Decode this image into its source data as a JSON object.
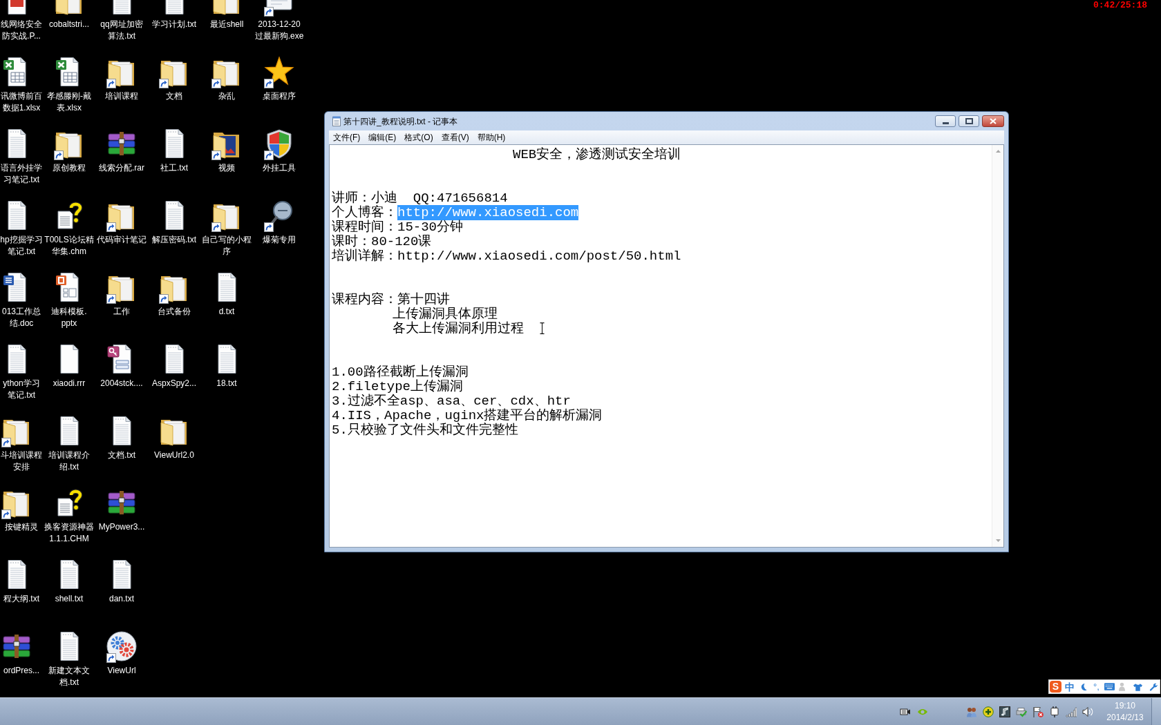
{
  "recording_timer": "0:42/25:18",
  "desktop": {
    "rows": [
      {
        "icons": [
          {
            "label": "线网络安全防实战.P...",
            "kind": "document",
            "shortcut": false
          },
          {
            "label": "cobaltstri...",
            "kind": "folder",
            "shortcut": false
          },
          {
            "label": "qq网址加密算法.txt",
            "kind": "text-file",
            "shortcut": false
          },
          {
            "label": "学习计划.txt",
            "kind": "text-file",
            "shortcut": false
          },
          {
            "label": "最近shell",
            "kind": "folder",
            "shortcut": false
          },
          {
            "label": "2013-12-20过最新狗.exe",
            "kind": "program",
            "shortcut": true
          }
        ]
      },
      {
        "icons": [
          {
            "label": "讯微博前百数据1.xlsx",
            "kind": "spreadsheet",
            "shortcut": false
          },
          {
            "label": "孝感滕刚-戴表.xlsx",
            "kind": "spreadsheet",
            "shortcut": false
          },
          {
            "label": "培训课程",
            "kind": "folder",
            "shortcut": true
          },
          {
            "label": "文档",
            "kind": "folder",
            "shortcut": true
          },
          {
            "label": "杂乱",
            "kind": "folder",
            "shortcut": true
          },
          {
            "label": "桌面程序",
            "kind": "star",
            "shortcut": true
          }
        ]
      },
      {
        "icons": [
          {
            "label": "语言外挂学习笔记.txt",
            "kind": "text-file",
            "shortcut": false
          },
          {
            "label": "原创教程",
            "kind": "folder",
            "shortcut": true
          },
          {
            "label": "线索分配.rar",
            "kind": "archive",
            "shortcut": false
          },
          {
            "label": "社工.txt",
            "kind": "text-file",
            "shortcut": false
          },
          {
            "label": "视频",
            "kind": "media-folder",
            "shortcut": true
          },
          {
            "label": "外挂工具",
            "kind": "shield",
            "shortcut": true
          }
        ]
      },
      {
        "icons": [
          {
            "label": "hp挖掘学习笔记.txt",
            "kind": "text-file",
            "shortcut": false
          },
          {
            "label": "T00LS论坛精华集.chm",
            "kind": "help-file",
            "shortcut": false
          },
          {
            "label": "代码审计笔记",
            "kind": "folder",
            "shortcut": true
          },
          {
            "label": "解压密码.txt",
            "kind": "text-file",
            "shortcut": false
          },
          {
            "label": "自己写的小程序",
            "kind": "folder",
            "shortcut": true
          },
          {
            "label": "爆菊专用",
            "kind": "magnifier",
            "shortcut": true
          }
        ]
      },
      {
        "icons": [
          {
            "label": "013工作总结.doc",
            "kind": "word-document",
            "shortcut": false
          },
          {
            "label": "迪科模板.pptx",
            "kind": "presentation",
            "shortcut": false
          },
          {
            "label": "工作",
            "kind": "folder",
            "shortcut": true
          },
          {
            "label": "台式备份",
            "kind": "folder",
            "shortcut": true
          },
          {
            "label": "d.txt",
            "kind": "text-file",
            "shortcut": false
          }
        ]
      },
      {
        "icons": [
          {
            "label": "ython学习笔记.txt",
            "kind": "text-file",
            "shortcut": false
          },
          {
            "label": "xiaodi.rrr",
            "kind": "blank-file",
            "shortcut": false
          },
          {
            "label": "2004stck....",
            "kind": "database-file",
            "shortcut": false
          },
          {
            "label": "AspxSpy2...",
            "kind": "text-file",
            "shortcut": false
          },
          {
            "label": "18.txt",
            "kind": "text-file",
            "shortcut": false
          }
        ]
      },
      {
        "icons": [
          {
            "label": "斗培训课程安排",
            "kind": "folder",
            "shortcut": true
          },
          {
            "label": "培训课程介绍.txt",
            "kind": "text-file",
            "shortcut": false
          },
          {
            "label": "文档.txt",
            "kind": "text-file",
            "shortcut": false
          },
          {
            "label": "ViewUrl2.0",
            "kind": "folder",
            "shortcut": false
          }
        ]
      },
      {
        "icons": [
          {
            "label": "按键精灵",
            "kind": "folder",
            "shortcut": true
          },
          {
            "label": "换客资源神器1.1.1.CHM",
            "kind": "help-file",
            "shortcut": false
          },
          {
            "label": "MyPower3...",
            "kind": "archive",
            "shortcut": false
          }
        ]
      },
      {
        "icons": [
          {
            "label": "程大纲.txt",
            "kind": "text-file",
            "shortcut": false
          },
          {
            "label": "shell.txt",
            "kind": "text-file",
            "shortcut": false
          },
          {
            "label": "dan.txt",
            "kind": "text-file",
            "shortcut": false
          }
        ]
      },
      {
        "icons": [
          {
            "label": "ordPres...",
            "kind": "archive",
            "shortcut": false
          },
          {
            "label": "新建文本文档.txt",
            "kind": "text-file",
            "shortcut": false
          },
          {
            "label": "ViewUrl",
            "kind": "gears",
            "shortcut": true
          }
        ]
      }
    ]
  },
  "notepad": {
    "title": "第十四讲_教程说明.txt - 记事本",
    "menu": [
      "文件(F)",
      "编辑(E)",
      "格式(O)",
      "查看(V)",
      "帮助(H)"
    ],
    "paragraphs": [
      {
        "lines": [
          {
            "kind": "heading",
            "segments": [
              {
                "text": "WEB安全，渗透测试安全培训",
                "selected": false
              }
            ]
          }
        ]
      },
      {
        "lines": [
          {
            "kind": "plain",
            "segments": [
              {
                "text": "讲师：小迪  QQ:471656814",
                "selected": false
              }
            ]
          },
          {
            "kind": "plain",
            "segments": [
              {
                "text": "个人博客：",
                "selected": false
              },
              {
                "text": "http://www.xiaosedi.com",
                "selected": true
              }
            ]
          },
          {
            "kind": "plain",
            "segments": [
              {
                "text": "课程时间：15-30分钟",
                "selected": false
              }
            ]
          },
          {
            "kind": "plain",
            "segments": [
              {
                "text": "课时：80-120课",
                "selected": false
              }
            ]
          },
          {
            "kind": "plain",
            "segments": [
              {
                "text": "培训详解：http://www.xiaosedi.com/post/50.html",
                "selected": false
              }
            ]
          }
        ]
      },
      {
        "lines": [
          {
            "kind": "plain",
            "segments": [
              {
                "text": "课程内容：第十四讲",
                "selected": false
              }
            ]
          },
          {
            "kind": "indented",
            "segments": [
              {
                "text": "上传漏洞具体原理",
                "selected": false
              }
            ]
          },
          {
            "kind": "indented",
            "segments": [
              {
                "text": "各大上传漏洞利用过程",
                "selected": false
              }
            ]
          }
        ]
      },
      {
        "lines": [
          {
            "kind": "plain",
            "segments": [
              {
                "text": "1.00路径截断上传漏洞",
                "selected": false
              }
            ]
          },
          {
            "kind": "plain",
            "segments": [
              {
                "text": "2.filetype上传漏洞",
                "selected": false
              }
            ]
          },
          {
            "kind": "plain",
            "segments": [
              {
                "text": "3.过滤不全asp、asa、cer、cdx、htr",
                "selected": false
              }
            ]
          },
          {
            "kind": "plain",
            "segments": [
              {
                "text": "4.IIS，Apache，uginx搭建平台的解析漏洞",
                "selected": false
              }
            ]
          },
          {
            "kind": "plain",
            "segments": [
              {
                "text": "5.只校验了文件头和文件完整性",
                "selected": false
              }
            ]
          }
        ]
      }
    ]
  },
  "ime_bar": {
    "logo": "S",
    "mode": "中",
    "punctuation": "°,"
  },
  "taskbar": {
    "clock_time": "19:10",
    "clock_date": "2014/2/13"
  }
}
